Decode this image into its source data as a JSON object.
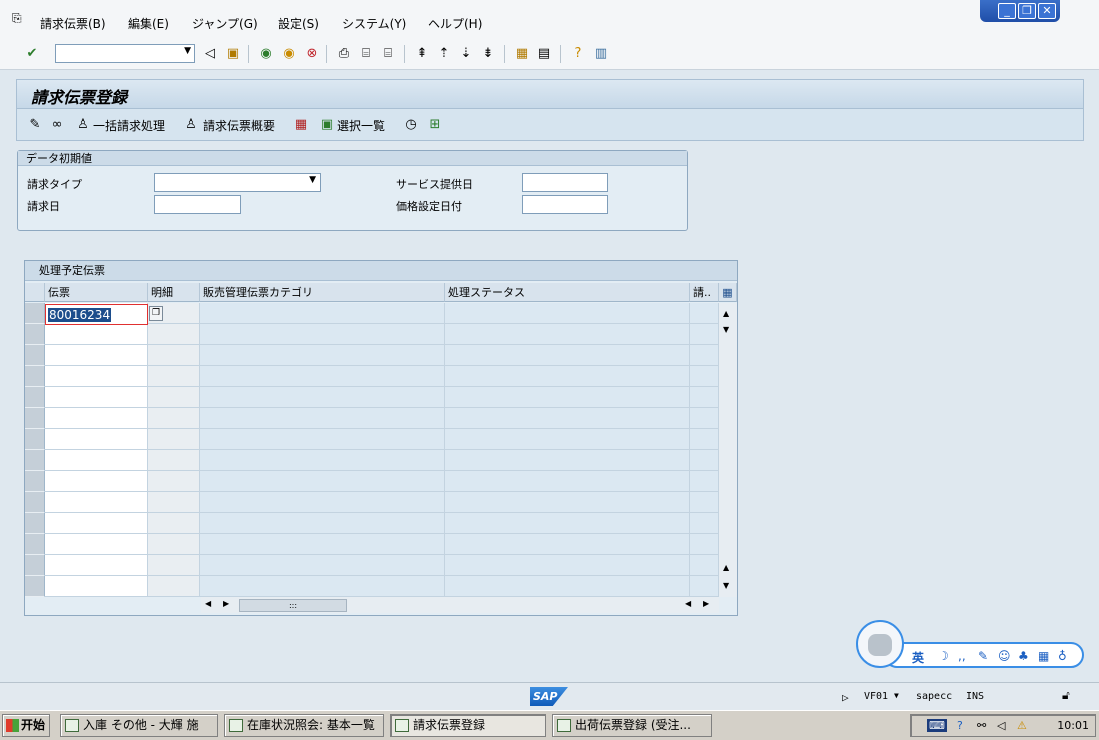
{
  "menubar": {
    "items": [
      "請求伝票(B)",
      "編集(E)",
      "ジャンプ(G)",
      "設定(S)",
      "システム(Y)",
      "ヘルプ(H)"
    ]
  },
  "window_controls": {
    "minimize": "_",
    "restore": "❐",
    "close": "✕"
  },
  "toolbar": {
    "command_value": ""
  },
  "screen": {
    "title": "請求伝票登録"
  },
  "app_toolbar": {
    "mass_billing": "一括請求処理",
    "billing_overview": "請求伝票概要",
    "selection_list": "選択一覧"
  },
  "initial_values": {
    "title": "データ初期値",
    "billing_type_label": "請求タイプ",
    "billing_type_value": "",
    "billing_date_label": "請求日",
    "billing_date_value": "",
    "service_date_label": "サービス提供日",
    "service_date_value": "",
    "pricing_date_label": "価格設定日付",
    "pricing_date_value": ""
  },
  "docs_table": {
    "title": "処理予定伝票",
    "columns": [
      "伝票",
      "明細",
      "販売管理伝票カテゴリ",
      "処理ステータス",
      "請.."
    ],
    "rows": [
      {
        "document": "80016234"
      }
    ]
  },
  "statusbar": {
    "transaction": "VF01",
    "system": "sapecc",
    "mode": "INS"
  },
  "ime": {
    "lang": "英"
  },
  "taskbar": {
    "start": "开始",
    "tasks": [
      "入庫 その他 - 大輝 施",
      "在庫状況照会: 基本一覧",
      "請求伝票登録",
      "出荷伝票登録 (受注..."
    ],
    "clock": "10:01"
  }
}
